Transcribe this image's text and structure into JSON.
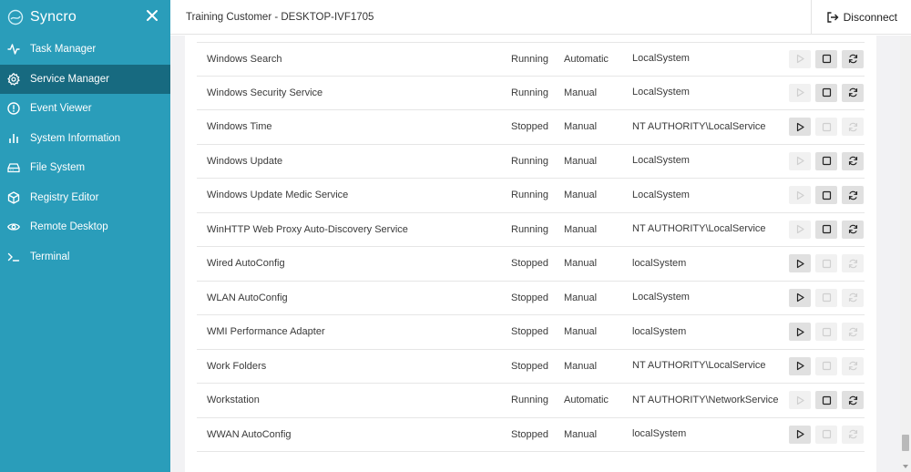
{
  "brand": {
    "name": "Syncro"
  },
  "sidebar": {
    "items": [
      {
        "label": "Task Manager",
        "icon": "activity-icon",
        "active": false
      },
      {
        "label": "Service Manager",
        "icon": "gear-icon",
        "active": true
      },
      {
        "label": "Event Viewer",
        "icon": "alert-circle-icon",
        "active": false
      },
      {
        "label": "System Information",
        "icon": "bar-chart-icon",
        "active": false
      },
      {
        "label": "File System",
        "icon": "hard-drive-icon",
        "active": false
      },
      {
        "label": "Registry Editor",
        "icon": "cube-icon",
        "active": false
      },
      {
        "label": "Remote Desktop",
        "icon": "eye-icon",
        "active": false
      },
      {
        "label": "Terminal",
        "icon": "terminal-icon",
        "active": false
      }
    ]
  },
  "header": {
    "title": "Training Customer - DESKTOP-IVF1705",
    "disconnect_label": "Disconnect"
  },
  "services": [
    {
      "name": "Windows Search",
      "status": "Running",
      "startup": "Automatic",
      "logon": "LocalSystem"
    },
    {
      "name": "Windows Security Service",
      "status": "Running",
      "startup": "Manual",
      "logon": "LocalSystem"
    },
    {
      "name": "Windows Time",
      "status": "Stopped",
      "startup": "Manual",
      "logon": "NT AUTHORITY\\LocalService"
    },
    {
      "name": "Windows Update",
      "status": "Running",
      "startup": "Manual",
      "logon": "LocalSystem"
    },
    {
      "name": "Windows Update Medic Service",
      "status": "Running",
      "startup": "Manual",
      "logon": "LocalSystem"
    },
    {
      "name": "WinHTTP Web Proxy Auto-Discovery Service",
      "status": "Running",
      "startup": "Manual",
      "logon": "NT AUTHORITY\\LocalService"
    },
    {
      "name": "Wired AutoConfig",
      "status": "Stopped",
      "startup": "Manual",
      "logon": "localSystem"
    },
    {
      "name": "WLAN AutoConfig",
      "status": "Stopped",
      "startup": "Manual",
      "logon": "LocalSystem"
    },
    {
      "name": "WMI Performance Adapter",
      "status": "Stopped",
      "startup": "Manual",
      "logon": "localSystem"
    },
    {
      "name": "Work Folders",
      "status": "Stopped",
      "startup": "Manual",
      "logon": "NT AUTHORITY\\LocalService"
    },
    {
      "name": "Workstation",
      "status": "Running",
      "startup": "Automatic",
      "logon": "NT AUTHORITY\\NetworkService"
    },
    {
      "name": "WWAN AutoConfig",
      "status": "Stopped",
      "startup": "Manual",
      "logon": "localSystem"
    }
  ],
  "colors": {
    "sidebar": "#2a9dba",
    "sidebar_active": "#176a80"
  }
}
